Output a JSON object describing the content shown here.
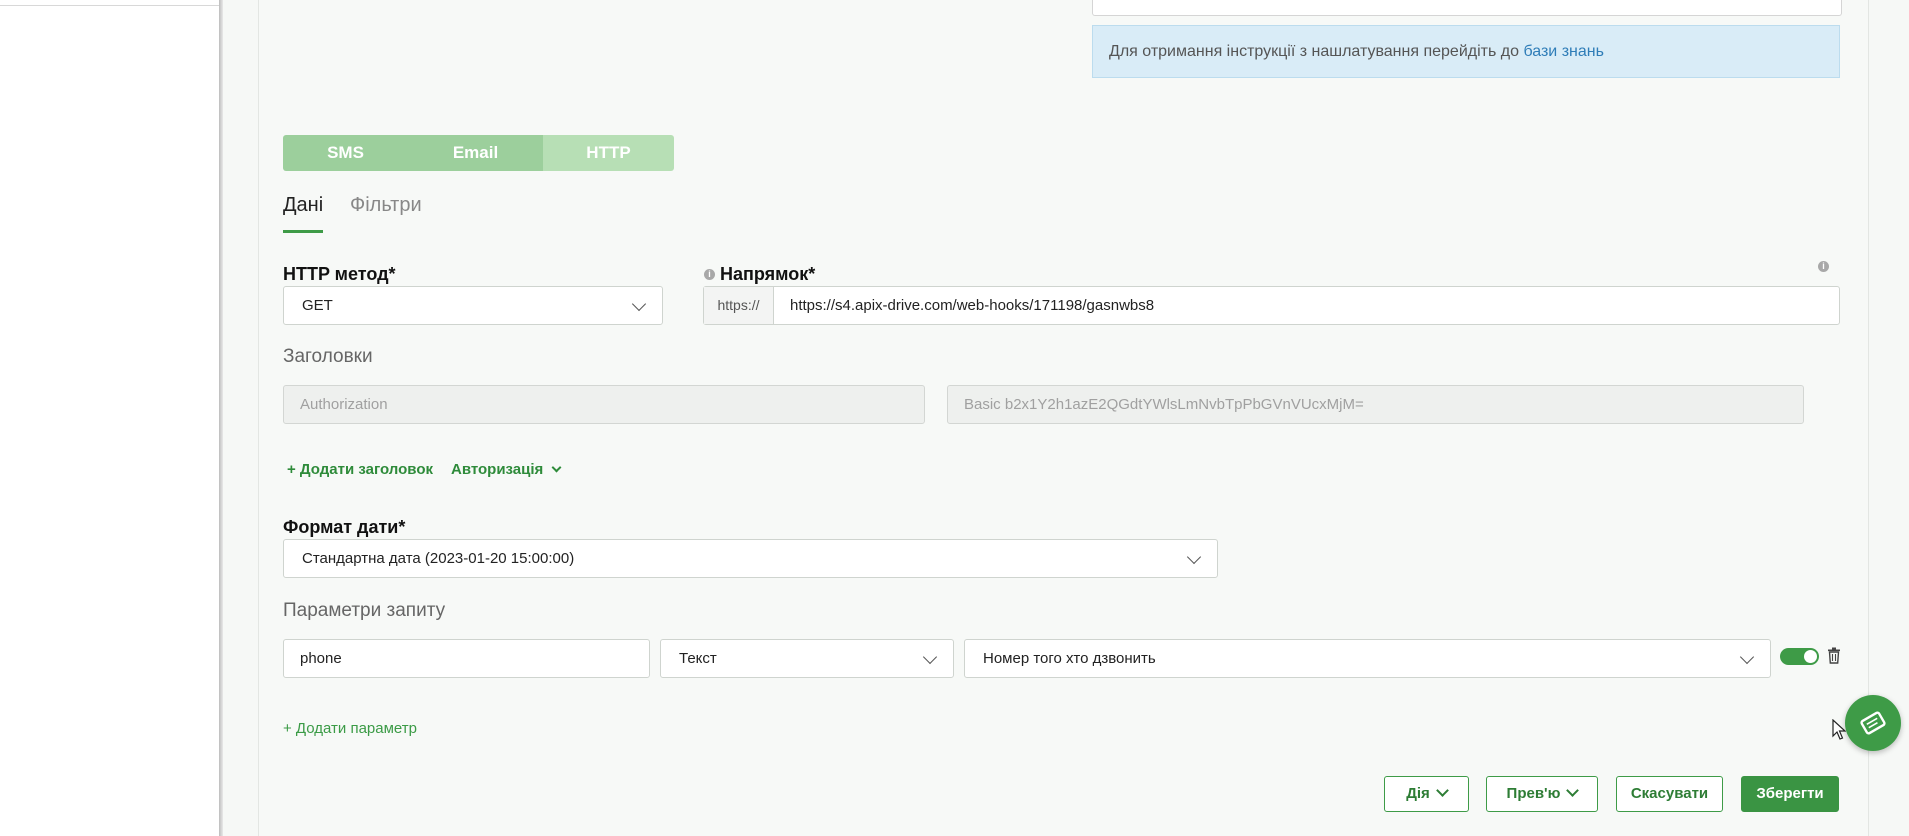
{
  "info": {
    "text": "Для отримання інструкції з нашлатування перейдіть до",
    "link": "бази знань"
  },
  "channel_tabs": [
    {
      "label": "SMS"
    },
    {
      "label": "Email"
    },
    {
      "label": "HTTP",
      "selected": true
    }
  ],
  "sub_tabs": [
    {
      "label": "Дані",
      "active": true
    },
    {
      "label": "Фільтри",
      "active": false
    }
  ],
  "http_method": {
    "label": "HTTP метод*",
    "value": "GET"
  },
  "direction": {
    "label": "Напрямок*",
    "prefix": "https://",
    "value": "https://s4.apix-drive.com/web-hooks/171198/gasnwbs8"
  },
  "headers": {
    "title": "Заголовки",
    "name_placeholder": "Authorization",
    "value_placeholder": "Basic b2x1Y2h1azE2QGdtYWlsLmNvbTpPbGVnVUcxMjM=",
    "add_label": "+ Додати заголовок",
    "auth_label": "Авторизація"
  },
  "date_format": {
    "label": "Формат дати*",
    "value": "Стандартна дата (2023-01-20 15:00:00)"
  },
  "params": {
    "title": "Параметри запиту",
    "rows": [
      {
        "name": "phone",
        "type": "Текст",
        "value": "Номер того хто дзвонить",
        "enabled": true
      }
    ],
    "add_label": "+ Додати параметр"
  },
  "footer": {
    "action": "Дія",
    "preview": "Прев'ю",
    "cancel": "Скасувати",
    "save": "Зберегти"
  },
  "colors": {
    "accent": "#3e9b47",
    "info_bg": "#d9ecf7",
    "link": "#2f7db8"
  },
  "icons": {
    "info": "info-icon",
    "trash": "trash-icon",
    "fab": "book-icon",
    "cursor": "mouse-pointer-icon"
  }
}
